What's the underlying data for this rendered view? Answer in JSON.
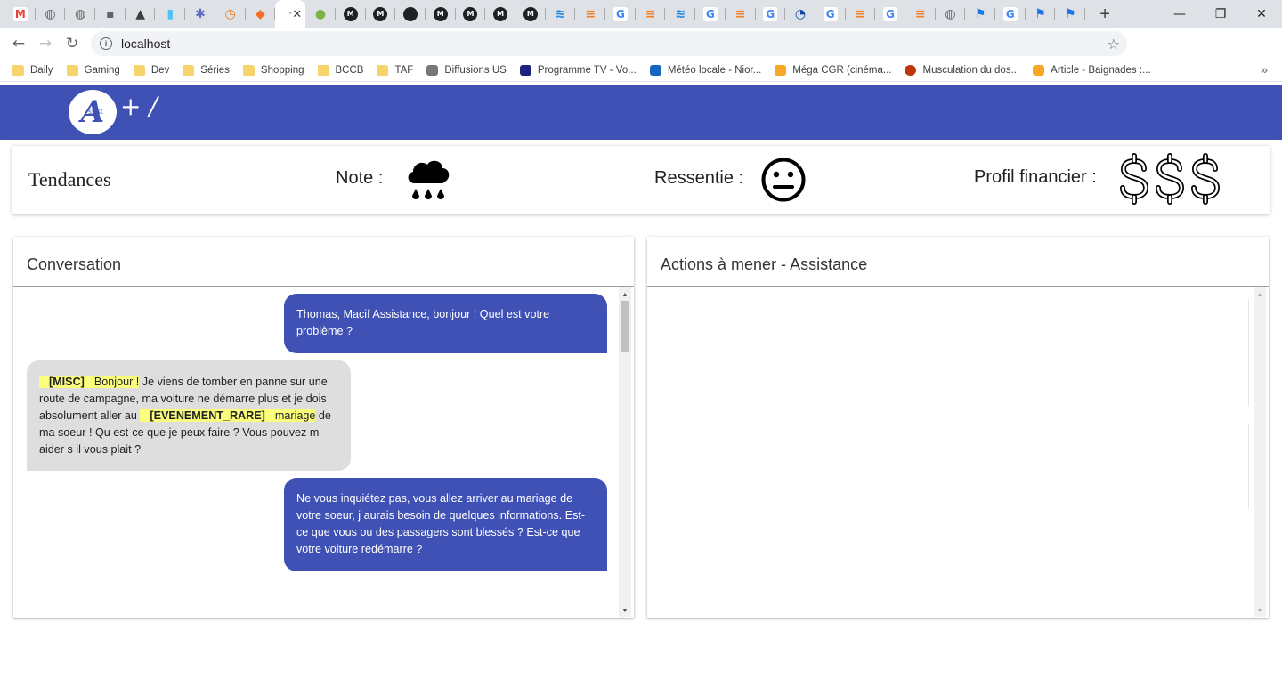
{
  "browser": {
    "tabs": [
      {
        "icon": "gmail-icon",
        "color": "#ea4335",
        "glyph": "M"
      },
      {
        "icon": "globe-icon",
        "color": "#5f6368",
        "glyph": "◍"
      },
      {
        "icon": "globe-icon",
        "color": "#5f6368",
        "glyph": "◍"
      },
      {
        "icon": "lock-icon",
        "color": "#5f6368",
        "glyph": "▪"
      },
      {
        "icon": "image-icon",
        "color": "#3c4043",
        "glyph": "▲"
      },
      {
        "icon": "battery-icon",
        "color": "#4fc3f7",
        "glyph": "▮"
      },
      {
        "icon": "gear-icon",
        "color": "#5c6bc0",
        "glyph": "✱"
      },
      {
        "icon": "clock-icon",
        "color": "#e67e22",
        "glyph": "◷"
      },
      {
        "icon": "gitlab-icon",
        "color": "#fc6d26",
        "glyph": "◆"
      },
      {
        "icon": "loading-icon",
        "color": "#ffffff",
        "glyph": "",
        "active": true
      },
      {
        "icon": "tennis-icon",
        "color": "#7cb342",
        "glyph": "●"
      },
      {
        "icon": "m-icon",
        "color": "#202124",
        "glyph": "M"
      },
      {
        "icon": "m-icon",
        "color": "#202124",
        "glyph": "M"
      },
      {
        "icon": "github-icon",
        "color": "#202124",
        "glyph": "●"
      },
      {
        "icon": "m-icon",
        "color": "#202124",
        "glyph": "M"
      },
      {
        "icon": "m-icon",
        "color": "#202124",
        "glyph": "M"
      },
      {
        "icon": "m-icon",
        "color": "#202124",
        "glyph": "M"
      },
      {
        "icon": "m-icon",
        "color": "#202124",
        "glyph": "M"
      },
      {
        "icon": "wave-icon",
        "color": "#1e88e5",
        "glyph": "≋"
      },
      {
        "icon": "stackoverflow-icon",
        "color": "#f48024",
        "glyph": "≡"
      },
      {
        "icon": "google-icon",
        "color": "#4285f4",
        "glyph": "G"
      },
      {
        "icon": "stackoverflow-icon",
        "color": "#f48024",
        "glyph": "≡"
      },
      {
        "icon": "wave-icon",
        "color": "#1e88e5",
        "glyph": "≋"
      },
      {
        "icon": "google-icon",
        "color": "#4285f4",
        "glyph": "G"
      },
      {
        "icon": "stackoverflow-icon",
        "color": "#f48024",
        "glyph": "≡"
      },
      {
        "icon": "google-icon",
        "color": "#4285f4",
        "glyph": "G"
      },
      {
        "icon": "loader-icon",
        "color": "#0d47a1",
        "glyph": "◔"
      },
      {
        "icon": "google-icon",
        "color": "#4285f4",
        "glyph": "G"
      },
      {
        "icon": "stackoverflow-icon",
        "color": "#f48024",
        "glyph": "≡"
      },
      {
        "icon": "google-icon",
        "color": "#4285f4",
        "glyph": "G"
      },
      {
        "icon": "stackoverflow-icon",
        "color": "#f48024",
        "glyph": "≡"
      },
      {
        "icon": "globe-icon",
        "color": "#5f6368",
        "glyph": "◍"
      },
      {
        "icon": "flag-icon",
        "color": "#1a73e8",
        "glyph": "⚑"
      },
      {
        "icon": "google-icon",
        "color": "#4285f4",
        "glyph": "G"
      },
      {
        "icon": "flag-icon",
        "color": "#1a73e8",
        "glyph": "⚑"
      },
      {
        "icon": "flag-icon",
        "color": "#1a73e8",
        "glyph": "⚑"
      }
    ],
    "new_tab": "+",
    "window_controls": {
      "minimize": "—",
      "maximize": "❐",
      "close": "✕"
    },
    "url": "localhost",
    "bookmarks": [
      {
        "label": "Daily",
        "icon": "folder"
      },
      {
        "label": "Gaming",
        "icon": "folder"
      },
      {
        "label": "Dev",
        "icon": "folder"
      },
      {
        "label": "Séries",
        "icon": "folder"
      },
      {
        "label": "Shopping",
        "icon": "folder"
      },
      {
        "label": "BCCB",
        "icon": "folder"
      },
      {
        "label": "TAF",
        "icon": "folder"
      },
      {
        "label": "Diffusions US",
        "icon": "grid",
        "color": "#777777"
      },
      {
        "label": "Programme TV - Vo...",
        "icon": "tv",
        "color": "#1a237e"
      },
      {
        "label": "Météo locale - Nior...",
        "icon": "weather",
        "color": "#1565c0"
      },
      {
        "label": "Méga CGR (cinéma...",
        "icon": "cinema",
        "color": "#f9a825"
      },
      {
        "label": "Musculation du dos...",
        "icon": "muscle",
        "color": "#bf360c"
      },
      {
        "label": "Article - Baignades :...",
        "icon": "article",
        "color": "#f9a825"
      }
    ],
    "bookmarks_more": "»"
  },
  "app": {
    "logo_letter": "A",
    "logo_text": "ssist",
    "logo_plus": "+ /",
    "trends": {
      "title": "Tendances",
      "note_label": "Note :",
      "note_icon": "rain-cloud-icon",
      "feeling_label": "Ressentie :",
      "feeling_icon": "neutral-face-icon",
      "finance_label": "Profil financier :",
      "finance_icon": "dollar-icon",
      "finance_level": 3
    },
    "conversation": {
      "title": "Conversation",
      "messages": [
        {
          "from": "agent",
          "text": "Thomas, Macif Assistance, bonjour ! Quel est votre problème ?"
        },
        {
          "from": "client",
          "tag1": "[MISC]",
          "hl1": "Bonjour !",
          "text1": " Je viens de tomber en panne sur une route de campagne, ma voiture ne démarre plus et je dois absolument aller au ",
          "tag2": "[EVENEMENT_RARE]",
          "hl2": "mariage",
          "text2": " de ma soeur ! Qu est-ce que je peux faire ? Vous pouvez m aider s il vous plait ?"
        },
        {
          "from": "agent",
          "text": "Ne vous inquiétez pas, vous allez arriver au mariage de votre soeur, j aurais besoin de quelques informations. Est-ce que vous ou des passagers sont blessés ? Est-ce que votre voiture redémarre ?"
        }
      ]
    },
    "actions": {
      "title": "Actions à mener - Assistance"
    }
  }
}
